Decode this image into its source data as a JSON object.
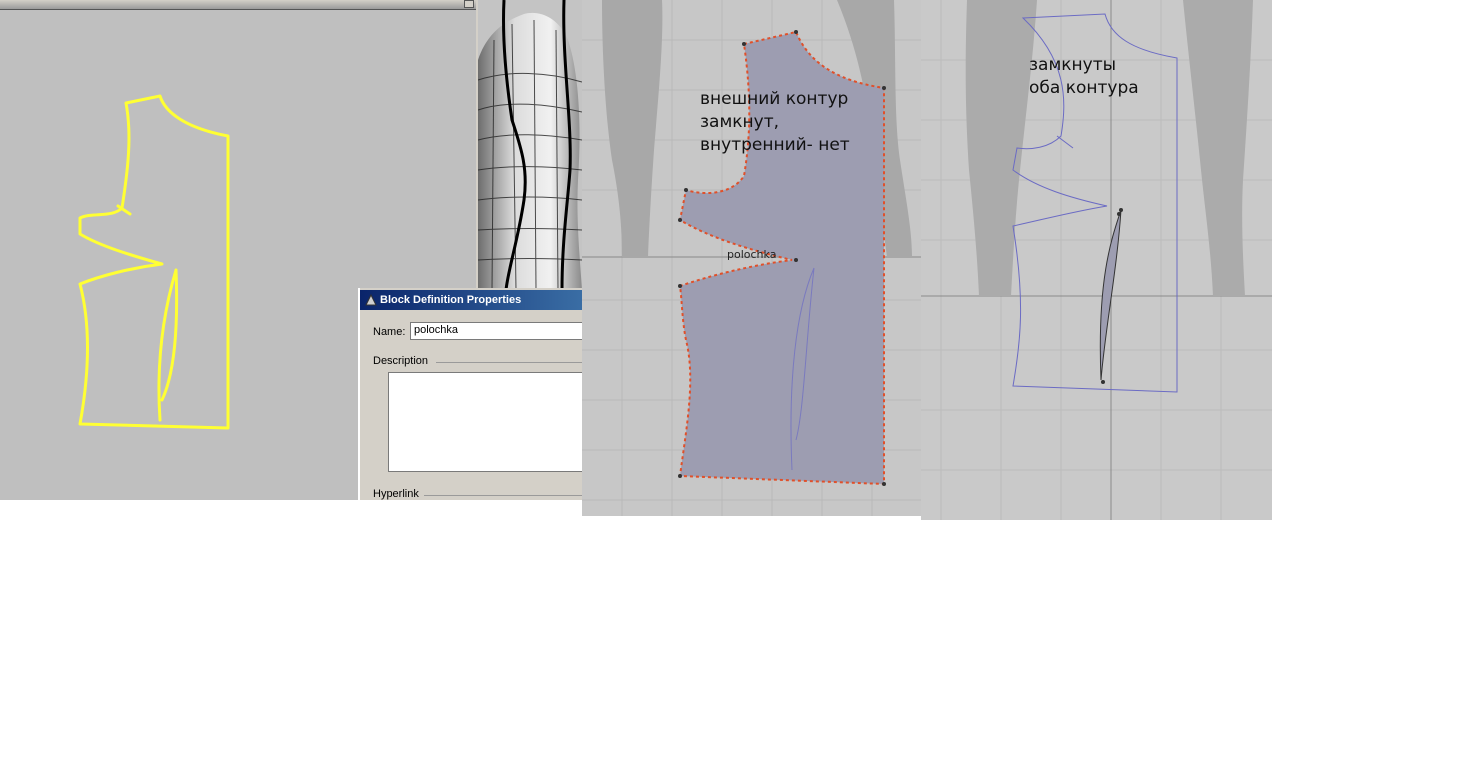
{
  "dialog": {
    "title": "Block Definition Properties",
    "name_label": "Name:",
    "name_value": "polochka",
    "description_label": "Description",
    "hyperlink_label": "Hyperlink"
  },
  "middle_view": {
    "annotation": "внешний контур\nзамкнут,\nвнутренний- нет",
    "block_label": "polochka"
  },
  "right_view": {
    "annotation": "замкнуты\nоба контура"
  },
  "colors": {
    "sketch_yellow": "#ffff33",
    "pattern_fill": "#9d9db1",
    "edit_points": "#e0502a",
    "curve_blue": "#6b6bc4"
  }
}
